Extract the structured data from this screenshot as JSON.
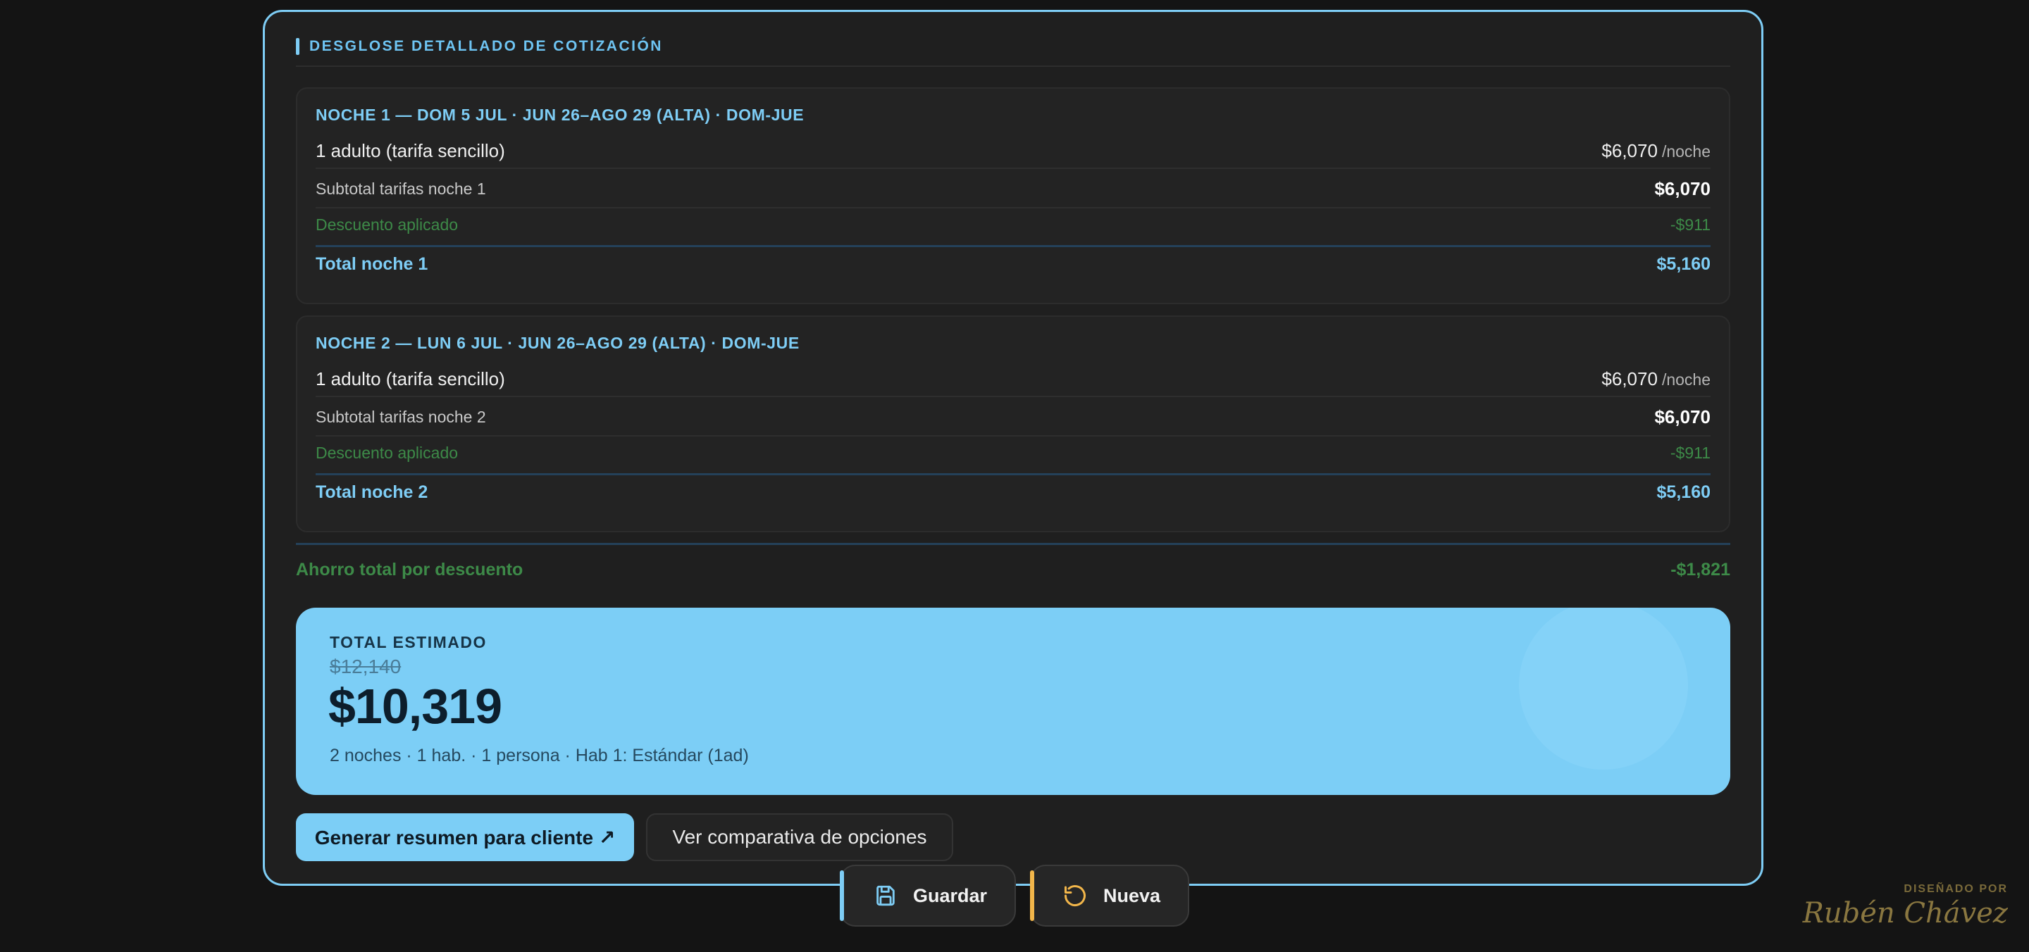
{
  "breakdown": {
    "title": "DESGLOSE DETALLADO DE COTIZACIÓN",
    "nights": [
      {
        "header": "NOCHE 1 — DOM 5 JUL · JUN 26–AGO 29 (ALTA) · DOM-JUE",
        "line_label": "1 adulto (tarifa sencillo)",
        "line_price": "$6,070",
        "line_unit": "/noche",
        "subtotal_label": "Subtotal tarifas noche 1",
        "subtotal_value": "$6,070",
        "discount_label": "Descuento aplicado",
        "discount_value": "-$911",
        "total_label": "Total noche 1",
        "total_value": "$5,160"
      },
      {
        "header": "NOCHE 2 — LUN 6 JUL · JUN 26–AGO 29 (ALTA) · DOM-JUE",
        "line_label": "1 adulto (tarifa sencillo)",
        "line_price": "$6,070",
        "line_unit": "/noche",
        "subtotal_label": "Subtotal tarifas noche 2",
        "subtotal_value": "$6,070",
        "discount_label": "Descuento aplicado",
        "discount_value": "-$911",
        "total_label": "Total noche 2",
        "total_value": "$5,160"
      }
    ],
    "savings_label": "Ahorro total por descuento",
    "savings_value": "-$1,821"
  },
  "total": {
    "label": "TOTAL ESTIMADO",
    "original": "$12,140",
    "amount": "$10,319",
    "meta": "2 noches · 1 hab. · 1 persona · Hab 1: Estándar (1ad)"
  },
  "actions": {
    "primary_label": "Generar resumen para cliente ↗",
    "secondary_label": "Ver comparativa de opciones"
  },
  "floating": {
    "save_label": "Guardar",
    "new_label": "Nueva"
  },
  "credit": {
    "kicker": "DISEÑADO POR",
    "name": "Rubén Chávez"
  },
  "colors": {
    "accent": "#7ecdf5",
    "discount": "#3d8a48",
    "new_accent": "#f2b64a",
    "background": "#141414"
  },
  "icons": {
    "save": "floppy-disk-icon",
    "new": "rotate-ccw-icon"
  }
}
